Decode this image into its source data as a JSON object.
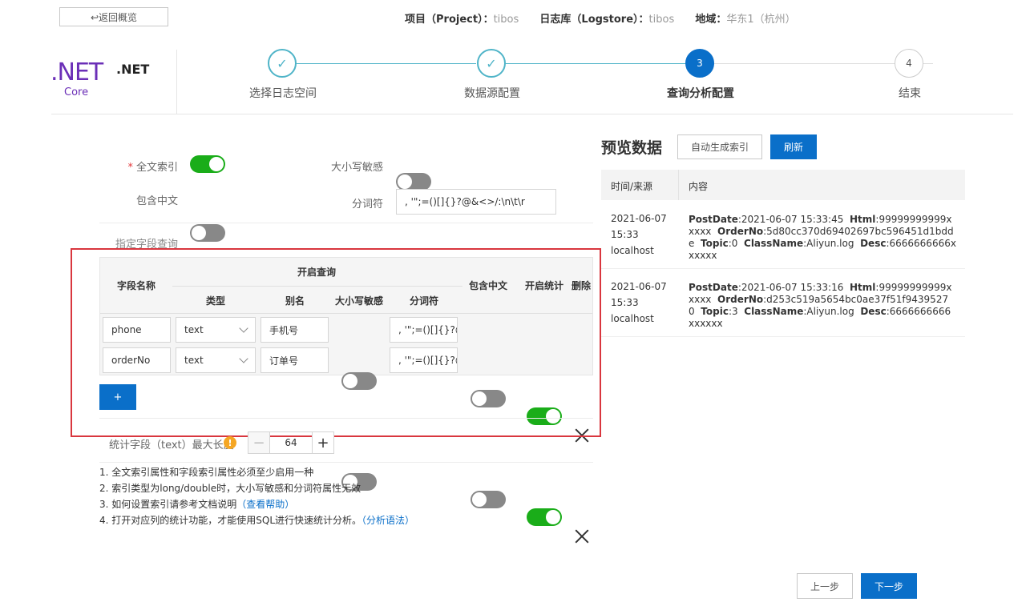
{
  "header": {
    "back_label": "↩返回概览",
    "project_key": "项目（Project）：",
    "project_value": "tibos",
    "logstore_key": "日志库（Logstore）：",
    "logstore_value": "tibos",
    "region_key": "地域：",
    "region_value": "华东1（杭州）"
  },
  "logo": {
    "net": ".NET",
    "core": "Core",
    "title": ".NET"
  },
  "steps": [
    {
      "num": "✓",
      "label": "选择日志空间",
      "state": "done"
    },
    {
      "num": "✓",
      "label": "数据源配置",
      "state": "done"
    },
    {
      "num": "3",
      "label": "查询分析配置",
      "state": "active"
    },
    {
      "num": "4",
      "label": "结束",
      "state": "todo"
    }
  ],
  "form": {
    "fulltext_label": "全文索引",
    "case_label": "大小写敏感",
    "chinese_label": "包含中文",
    "delimiter_label": "分词符",
    "delimiter_value": ", '\";=()[]{}?@&<>/:\\n\\t\\r",
    "field_section_title": "指定字段查询"
  },
  "table": {
    "col_field_name": "字段名称",
    "col_enable_query": "开启查询",
    "col_type": "类型",
    "col_alias": "别名",
    "col_case": "大小写敏感",
    "col_delimiter": "分词符",
    "col_chinese": "包含中文",
    "col_stats": "开启统计",
    "col_delete": "删除",
    "rows": [
      {
        "name": "phone",
        "type": "text",
        "alias": "手机号",
        "delimiter": ", '\";=()[]{}?@",
        "case_on": false,
        "chinese_on": false,
        "stats_on": true
      },
      {
        "name": "orderNo",
        "type": "text",
        "alias": "订单号",
        "delimiter": ", '\";=()[]{}?@",
        "case_on": false,
        "chinese_on": false,
        "stats_on": true
      }
    ],
    "add_label": "+"
  },
  "stats": {
    "label": "统计字段（text）最大长度",
    "warn": "!",
    "minus": "−",
    "value": "64",
    "plus": "+"
  },
  "notes": {
    "n1": "1. 全文索引属性和字段索引属性必须至少启用一种",
    "n2": "2. 索引类型为long/double时，大小写敏感和分词符属性无效",
    "n3": "3. 如何设置索引请参考文档说明",
    "n3_link": "（查看帮助）",
    "n4": "4. 打开对应列的统计功能，才能使用SQL进行快速统计分析。",
    "n4_link": "（分析语法）"
  },
  "preview": {
    "title": "预览数据",
    "auto_index_label": "自动生成索引",
    "refresh_label": "刷新",
    "col_time": "时间/来源",
    "col_content": "内容",
    "rows": [
      {
        "date": "2021-06-07",
        "time": "15:33",
        "source": "localhost",
        "postdate_k": "PostDate",
        "postdate_v": ":2021-06-07 15:33:45",
        "html_k": "Html",
        "html_v": ":99999999999xxxxx",
        "order_k": "OrderNo",
        "order_v": ":5d80cc370d69402697bc596451d1bdde",
        "topic_k": "Topic",
        "topic_v": ":0",
        "class_k": "ClassName",
        "class_v": ":Aliyun.log",
        "desc_k": "Desc",
        "desc_v": ":6666666666xxxxxx"
      },
      {
        "date": "2021-06-07",
        "time": "15:33",
        "source": "localhost",
        "postdate_k": "PostDate",
        "postdate_v": ":2021-06-07 15:33:16",
        "html_k": "Html",
        "html_v": ":99999999999xxxxx",
        "order_k": "OrderNo",
        "order_v": ":d253c519a5654bc0ae37f51f94395270",
        "topic_k": "Topic",
        "topic_v": ":3",
        "class_k": "ClassName",
        "class_v": ":Aliyun.log",
        "desc_k": "Desc",
        "desc_v": ":6666666666xxxxxx"
      }
    ]
  },
  "footer": {
    "prev_label": "上一步",
    "next_label": "下一步"
  },
  "colors": {
    "primary": "#0a6fc9",
    "switch_on": "#1aad19",
    "switch_off": "#888888",
    "highlight": "#d9363e",
    "logo": "#6b2fb7"
  },
  "toggles": {
    "fulltext_on": true,
    "case_on": false,
    "chinese_on": false
  }
}
